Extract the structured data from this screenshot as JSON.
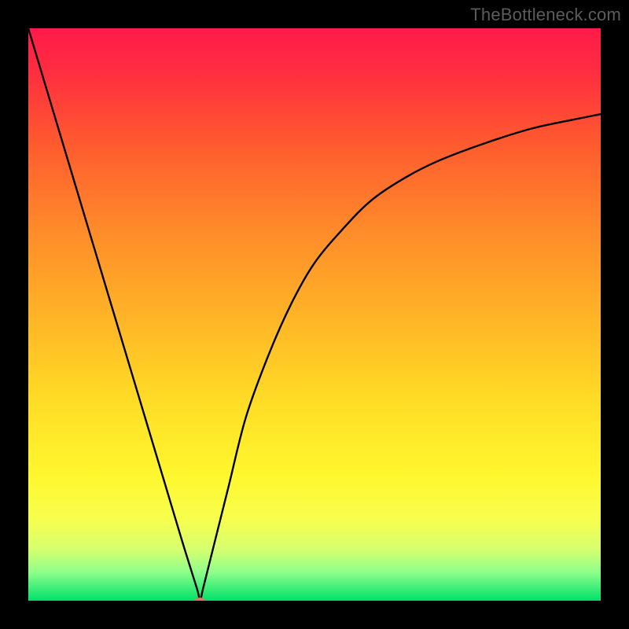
{
  "attribution": "TheBottleneck.com",
  "chart_data": {
    "type": "line",
    "title": "",
    "xlabel": "",
    "ylabel": "",
    "xlim": [
      0,
      100
    ],
    "ylim": [
      0,
      100
    ],
    "background_gradient_stops": [
      {
        "offset": 0.0,
        "color": "#ff1a4b"
      },
      {
        "offset": 0.08,
        "color": "#ff2f3f"
      },
      {
        "offset": 0.2,
        "color": "#ff5a2f"
      },
      {
        "offset": 0.35,
        "color": "#ff8a2a"
      },
      {
        "offset": 0.5,
        "color": "#ffb327"
      },
      {
        "offset": 0.65,
        "color": "#ffdc26"
      },
      {
        "offset": 0.78,
        "color": "#fff72e"
      },
      {
        "offset": 0.86,
        "color": "#f6ff4f"
      },
      {
        "offset": 0.91,
        "color": "#d6ff6f"
      },
      {
        "offset": 0.95,
        "color": "#8fff8a"
      },
      {
        "offset": 1.0,
        "color": "#00e06a"
      }
    ],
    "series": [
      {
        "name": "bottleneck-curve",
        "x": [
          0,
          3,
          6,
          9,
          12,
          15,
          18,
          21,
          24,
          27,
          29.5,
          30,
          30.5,
          32,
          35,
          38,
          42,
          46,
          50,
          55,
          60,
          66,
          72,
          80,
          88,
          95,
          100
        ],
        "values": [
          100,
          90,
          80,
          70,
          60,
          50,
          40,
          30,
          20,
          10,
          2,
          0,
          2,
          8,
          20,
          32,
          43,
          52,
          59,
          65,
          70,
          74,
          77,
          80,
          82.5,
          84,
          85
        ]
      }
    ],
    "marker": {
      "x": 30,
      "y": 0,
      "color": "#d37a5f",
      "rx": 7,
      "ry": 4
    }
  }
}
